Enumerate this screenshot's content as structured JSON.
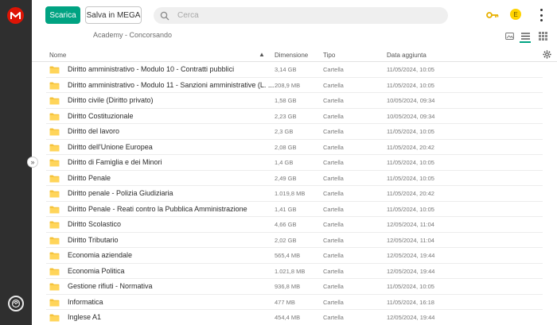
{
  "toolbar": {
    "download_label": "Scarica",
    "save_label": "Salva in MEGA",
    "search_placeholder": "Cerca",
    "avatar_initial": "E",
    "accent_color": "#00a382",
    "brand_color": "#dd1405"
  },
  "breadcrumb": "Academy - Concorsando",
  "columns": {
    "name": "Nome",
    "size": "Dimensione",
    "type": "Tipo",
    "date": "Data aggiunta"
  },
  "rows": [
    {
      "name": "Diritto amministrativo - Modulo 10 - Contratti pubblici",
      "size": "3,14 GB",
      "type": "Cartella",
      "date": "11/05/2024, 10:05"
    },
    {
      "name": "Diritto amministrativo - Modulo 11 - Sanzioni amministrative (L. ...",
      "size": "208,9 MB",
      "type": "Cartella",
      "date": "11/05/2024, 10:05"
    },
    {
      "name": "Diritto civile (Diritto privato)",
      "size": "1,58 GB",
      "type": "Cartella",
      "date": "10/05/2024, 09:34"
    },
    {
      "name": "Diritto Costituzionale",
      "size": "2,23 GB",
      "type": "Cartella",
      "date": "10/05/2024, 09:34"
    },
    {
      "name": "Diritto del lavoro",
      "size": "2,3 GB",
      "type": "Cartella",
      "date": "11/05/2024, 10:05"
    },
    {
      "name": "Diritto dell'Unione Europea",
      "size": "2,08 GB",
      "type": "Cartella",
      "date": "11/05/2024, 20:42"
    },
    {
      "name": "Diritto di Famiglia e dei Minori",
      "size": "1,4 GB",
      "type": "Cartella",
      "date": "11/05/2024, 10:05"
    },
    {
      "name": "Diritto Penale",
      "size": "2,49 GB",
      "type": "Cartella",
      "date": "11/05/2024, 10:05"
    },
    {
      "name": "Diritto penale - Polizia Giudiziaria",
      "size": "1.019,8 MB",
      "type": "Cartella",
      "date": "11/05/2024, 20:42"
    },
    {
      "name": "Diritto Penale - Reati contro la Pubblica Amministrazione",
      "size": "1,41 GB",
      "type": "Cartella",
      "date": "11/05/2024, 10:05"
    },
    {
      "name": "Diritto Scolastico",
      "size": "4,66 GB",
      "type": "Cartella",
      "date": "12/05/2024, 11:04"
    },
    {
      "name": "Diritto Tributario",
      "size": "2,02 GB",
      "type": "Cartella",
      "date": "12/05/2024, 11:04"
    },
    {
      "name": "Economia aziendale",
      "size": "565,4 MB",
      "type": "Cartella",
      "date": "12/05/2024, 19:44"
    },
    {
      "name": "Economia Politica",
      "size": "1.021,8 MB",
      "type": "Cartella",
      "date": "12/05/2024, 19:44"
    },
    {
      "name": "Gestione rifiuti - Normativa",
      "size": "936,8 MB",
      "type": "Cartella",
      "date": "11/05/2024, 10:05"
    },
    {
      "name": "Informatica",
      "size": "477 MB",
      "type": "Cartella",
      "date": "11/05/2024, 16:18"
    },
    {
      "name": "Inglese A1",
      "size": "454,4 MB",
      "type": "Cartella",
      "date": "12/05/2024, 19:44"
    }
  ]
}
